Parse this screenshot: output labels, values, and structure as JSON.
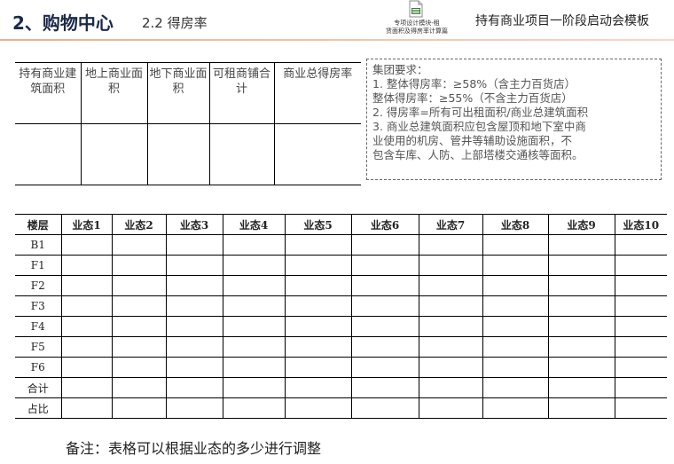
{
  "header": {
    "title": "2、购物中心",
    "subtitle": "2.2 得房率",
    "file_icon": "document-icon",
    "file_caption_1": "专项设计模块-租",
    "file_caption_2": "赁面积及得房率计算篇",
    "right_title": "持有商业项目一阶段启动会模板"
  },
  "area_table": {
    "headers": [
      "持有商业建筑面积",
      "地上商业面积",
      "地下商业面积",
      "可租商铺合计",
      "商业总得房率"
    ]
  },
  "requirements": {
    "lines": [
      "集团要求：",
      "1.    整体得房率：≥58%（含主力百货店）",
      "      整体得房率：≥55%（不含主力百货店）",
      "2.    得房率=所有可出租面积/商业总建筑面积",
      "3.    商业总建筑面积应包含屋顶和地下室中商",
      "        业使用的机房、管井等辅助设施面积，不",
      "        包含车库、人防、上部塔楼交通核等面积。"
    ]
  },
  "floor_table": {
    "headers": [
      "楼层",
      "业态1",
      "业态2",
      "业态3",
      "业态4",
      "业态5",
      "业态6",
      "业态7",
      "业态8",
      "业态9",
      "业态10"
    ],
    "rows": [
      "B1",
      "F1",
      "F2",
      "F3",
      "F4",
      "F5",
      "F6",
      "合计",
      "占比"
    ]
  },
  "note": "备注：表格可以根据业态的多少进行调整"
}
